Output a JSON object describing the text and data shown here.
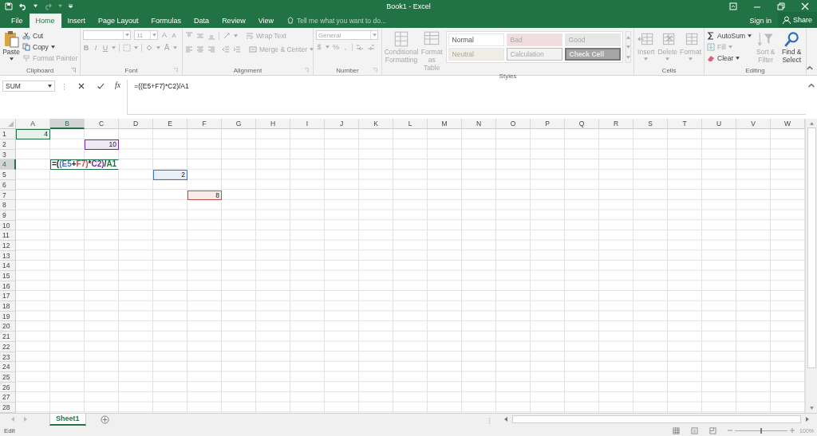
{
  "window": {
    "title": "Book1 - Excel"
  },
  "tabs": [
    {
      "label": "File",
      "selected": false
    },
    {
      "label": "Home",
      "selected": true
    },
    {
      "label": "Insert",
      "selected": false
    },
    {
      "label": "Page Layout",
      "selected": false
    },
    {
      "label": "Formulas",
      "selected": false
    },
    {
      "label": "Data",
      "selected": false
    },
    {
      "label": "Review",
      "selected": false
    },
    {
      "label": "View",
      "selected": false
    }
  ],
  "tell_me": {
    "placeholder": "Tell me what you want to do..."
  },
  "account": {
    "sign_in": "Sign in",
    "share": "Share"
  },
  "ribbon": {
    "clipboard": {
      "label": "Clipboard",
      "items": [
        {
          "label": "Paste",
          "kind": "paste",
          "disabled": false
        },
        {
          "label": "Cut",
          "kind": "cut",
          "disabled": false
        },
        {
          "label": "Copy",
          "kind": "copy",
          "disabled": false
        },
        {
          "label": "Format Painter",
          "kind": "painter",
          "disabled": true
        }
      ]
    },
    "font": {
      "label": "Font",
      "size": "11",
      "grow": "A",
      "shrink": "A",
      "styles": [
        "B",
        "I",
        "U"
      ],
      "font_color": "A",
      "disabled": true
    },
    "alignment": {
      "label": "Alignment",
      "wrap": "Wrap Text",
      "merge": "Merge & Center",
      "disabled": true
    },
    "number": {
      "label": "Number",
      "format": "General",
      "currency": "$",
      "percent": "%",
      "comma": ",",
      "disabled": true
    },
    "styles": {
      "label": "Styles",
      "conditional": "Conditional Formatting",
      "table": "Format as Table",
      "disabled": true,
      "cell_styles": [
        {
          "label": "Normal",
          "kind": "normal",
          "disabled": false
        },
        {
          "label": "Bad",
          "kind": "bad",
          "disabled": true
        },
        {
          "label": "Good",
          "kind": "good",
          "disabled": true
        },
        {
          "label": "Neutral",
          "kind": "neutral",
          "disabled": true
        },
        {
          "label": "Calculation",
          "kind": "calculation",
          "disabled": true
        },
        {
          "label": "Check Cell",
          "kind": "check",
          "disabled": true
        }
      ]
    },
    "cells": {
      "label": "Cells",
      "items": [
        "Insert",
        "Delete",
        "Format"
      ],
      "disabled": true
    },
    "editing": {
      "label": "Editing",
      "items": [
        {
          "label": "AutoSum",
          "kind": "autosum",
          "disabled": false
        },
        {
          "label": "Fill",
          "kind": "fill",
          "disabled": true
        },
        {
          "label": "Clear",
          "kind": "clear",
          "disabled": false
        },
        {
          "label": "Sort & Filter",
          "kind": "sort",
          "disabled": true
        },
        {
          "label": "Find & Select",
          "kind": "find",
          "disabled": false
        }
      ]
    }
  },
  "name_box": {
    "value": "SUM"
  },
  "formula_bar": {
    "function_label": "fx",
    "value": "=((E5+F7)*C2)/A1"
  },
  "columns": [
    {
      "label": "A",
      "selected": false
    },
    {
      "label": "B",
      "selected": true
    },
    {
      "label": "C",
      "selected": false
    },
    {
      "label": "D",
      "selected": false
    },
    {
      "label": "E",
      "selected": false
    },
    {
      "label": "F",
      "selected": false
    },
    {
      "label": "G",
      "selected": false
    },
    {
      "label": "H",
      "selected": false
    },
    {
      "label": "I",
      "selected": false
    },
    {
      "label": "J",
      "selected": false
    },
    {
      "label": "K",
      "selected": false
    },
    {
      "label": "L",
      "selected": false
    },
    {
      "label": "M",
      "selected": false
    },
    {
      "label": "N",
      "selected": false
    },
    {
      "label": "O",
      "selected": false
    },
    {
      "label": "P",
      "selected": false
    },
    {
      "label": "Q",
      "selected": false
    },
    {
      "label": "R",
      "selected": false
    },
    {
      "label": "S",
      "selected": false
    },
    {
      "label": "T",
      "selected": false
    },
    {
      "label": "U",
      "selected": false
    },
    {
      "label": "V",
      "selected": false
    },
    {
      "label": "W",
      "selected": false
    }
  ],
  "rows": [
    {
      "label": "1",
      "selected": false,
      "cells": {
        "A": {
          "kind": "reference",
          "value": "4",
          "color": "#217346"
        }
      }
    },
    {
      "label": "2",
      "selected": false,
      "cells": {
        "C": {
          "kind": "reference",
          "value": "10",
          "color": "#7030a0"
        }
      }
    },
    {
      "label": "3",
      "selected": false
    },
    {
      "label": "4",
      "selected": true,
      "cells": {
        "B": {
          "kind": "editing",
          "parts": [
            {
              "text": "=(",
              "kind": "plain"
            },
            {
              "text": "(E5",
              "kind": "reference",
              "color": "#4472c4"
            },
            {
              "text": "+",
              "kind": "plain"
            },
            {
              "text": "F7)",
              "kind": "reference",
              "color": "#c0504d"
            },
            {
              "text": "*",
              "kind": "plain"
            },
            {
              "text": "C2)",
              "kind": "reference",
              "color": "#7030a0"
            },
            {
              "text": "/",
              "kind": "plain"
            },
            {
              "text": "A1",
              "kind": "reference",
              "color": "#217346"
            }
          ]
        }
      }
    },
    {
      "label": "5",
      "selected": false,
      "cells": {
        "E": {
          "kind": "reference",
          "value": "2",
          "color": "#4472c4"
        }
      }
    },
    {
      "label": "6",
      "selected": false
    },
    {
      "label": "7",
      "selected": false,
      "cells": {
        "F": {
          "kind": "reference",
          "value": "8",
          "color": "#c0504d"
        }
      }
    },
    {
      "label": "8",
      "selected": false
    },
    {
      "label": "9",
      "selected": false
    },
    {
      "label": "10",
      "selected": false
    },
    {
      "label": "11",
      "selected": false
    },
    {
      "label": "12",
      "selected": false
    },
    {
      "label": "13",
      "selected": false
    },
    {
      "label": "14",
      "selected": false
    },
    {
      "label": "15",
      "selected": false
    },
    {
      "label": "16",
      "selected": false
    },
    {
      "label": "17",
      "selected": false
    },
    {
      "label": "18",
      "selected": false
    },
    {
      "label": "19",
      "selected": false
    },
    {
      "label": "20",
      "selected": false
    },
    {
      "label": "21",
      "selected": false
    },
    {
      "label": "22",
      "selected": false
    },
    {
      "label": "23",
      "selected": false
    },
    {
      "label": "24",
      "selected": false
    },
    {
      "label": "25",
      "selected": false
    },
    {
      "label": "26",
      "selected": false
    },
    {
      "label": "27",
      "selected": false
    },
    {
      "label": "28",
      "selected": false
    }
  ],
  "sheets": [
    {
      "label": "Sheet1",
      "selected": true
    }
  ],
  "status_bar": {
    "mode": "Edit",
    "zoom": {
      "label": "100%",
      "level": 0.5
    }
  }
}
